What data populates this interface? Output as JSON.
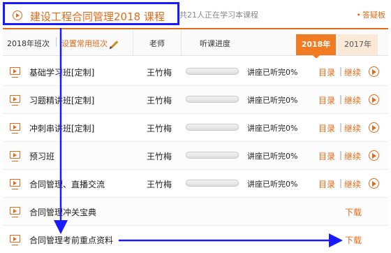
{
  "title": "建设工程合同管理2018  课程",
  "learners_text": "共21人正在学习本课程",
  "qa_label": "答疑板",
  "header": {
    "class_label": "2018年班次",
    "set_label": "设置常用班次",
    "teacher_label": "老师",
    "progress_label": "听课进度",
    "tabs": [
      "2018年",
      "2017年"
    ],
    "active_tab": "2018年"
  },
  "rows": [
    {
      "name": "基础学习班[定制]",
      "teacher": "王竹梅",
      "progress": 0,
      "progress_text": "讲座已听完0%",
      "dir": "目录",
      "cont": "继续"
    },
    {
      "name": "习题精讲班[定制]",
      "teacher": "王竹梅",
      "progress": 0,
      "progress_text": "讲座已听完0%",
      "dir": "目录",
      "cont": "继续"
    },
    {
      "name": "冲刺串讲班[定制]",
      "teacher": "王竹梅",
      "progress": 0,
      "progress_text": "讲座已听完0%",
      "dir": "目录",
      "cont": "继续"
    },
    {
      "name": "预习班",
      "teacher": "王竹梅",
      "progress": 0,
      "progress_text": "讲座已听完0%",
      "dir": "目录",
      "cont": "继续"
    },
    {
      "name": "合同管理、直播交流",
      "teacher": "王竹梅",
      "progress": 0,
      "progress_text": "讲座已听完0%",
      "dir": "目录",
      "cont": "继续"
    },
    {
      "name": "合同管理冲关宝典",
      "download": "下载"
    },
    {
      "name": "合同管理考前重点资料",
      "download": "下载"
    }
  ],
  "link_separator": "|",
  "colors": {
    "accent": "#e26a1a",
    "tab_active": "#f07b23",
    "annotation": "#1a1aff"
  }
}
